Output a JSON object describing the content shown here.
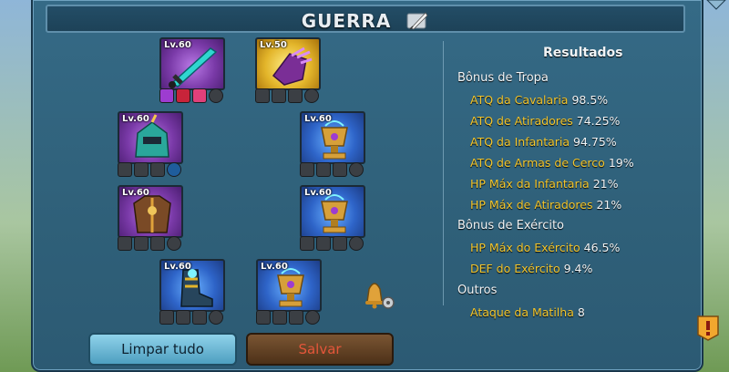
{
  "title": "GUERRA",
  "slots": [
    {
      "level": "Lv.60",
      "item": "sword"
    },
    {
      "level": "Lv.50",
      "item": "gauntlet"
    },
    {
      "level": "Lv.60",
      "item": "helmet"
    },
    {
      "level": "Lv.60",
      "item": "cup"
    },
    {
      "level": "Lv.60",
      "item": "armor"
    },
    {
      "level": "Lv.60",
      "item": "cup"
    },
    {
      "level": "Lv.60",
      "item": "boots"
    },
    {
      "level": "Lv.60",
      "item": "cup"
    }
  ],
  "results": {
    "heading": "Resultados",
    "troop_heading": "Bônus de Tropa",
    "troop": [
      {
        "name": "ATQ da Cavalaria",
        "value": "98.5%"
      },
      {
        "name": "ATQ de Atiradores",
        "value": "74.25%"
      },
      {
        "name": "ATQ da Infantaria",
        "value": "94.75%"
      },
      {
        "name": "ATQ de Armas de Cerco",
        "value": "19%"
      },
      {
        "name": "HP Máx da Infantaria",
        "value": "21%"
      },
      {
        "name": "HP Máx de Atiradores",
        "value": "21%"
      }
    ],
    "army_heading": "Bônus de Exército",
    "army": [
      {
        "name": "HP Máx do Exército",
        "value": "46.5%"
      },
      {
        "name": "DEF do Exército",
        "value": "9.4%"
      }
    ],
    "other_heading": "Outros",
    "other": [
      {
        "name": "Ataque da Matilha",
        "value": "8"
      }
    ]
  },
  "buttons": {
    "clear": "Limpar tudo",
    "save": "Salvar"
  },
  "icons": [
    "feather-icon",
    "bell-icon",
    "gear-icon",
    "alert-icon",
    "corner-arrow-icon"
  ]
}
